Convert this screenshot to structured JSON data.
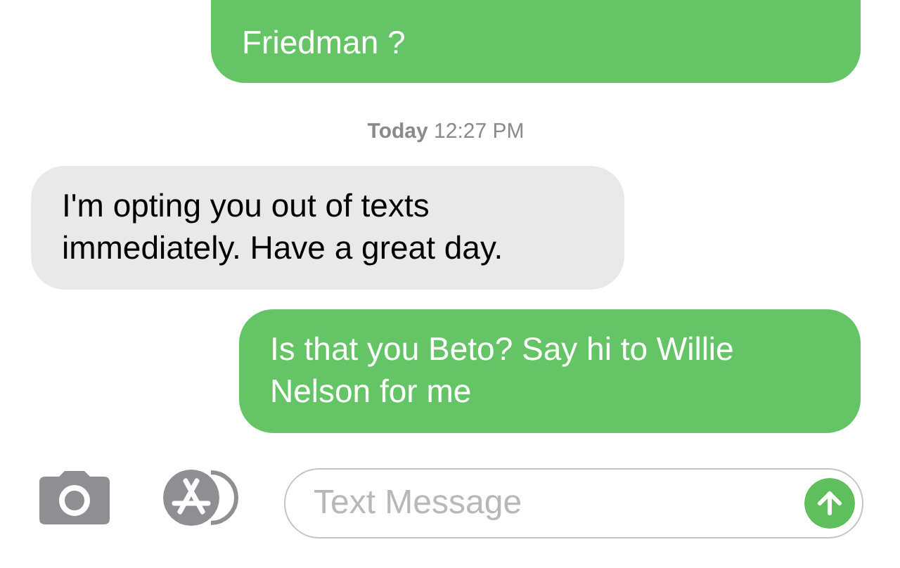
{
  "messages": [
    {
      "kind": "sent",
      "text": "Friedman ?"
    },
    {
      "kind": "timestamp",
      "text": "**Today** 12:27 PM"
    },
    {
      "kind": "received",
      "text": "I'm opting you out of texts immediately. Have a great day."
    },
    {
      "kind": "sent",
      "text": "Is that you Beto? Say hi to Willie Nelson for me"
    }
  ],
  "composer": {
    "placeholder": "Text Message"
  }
}
